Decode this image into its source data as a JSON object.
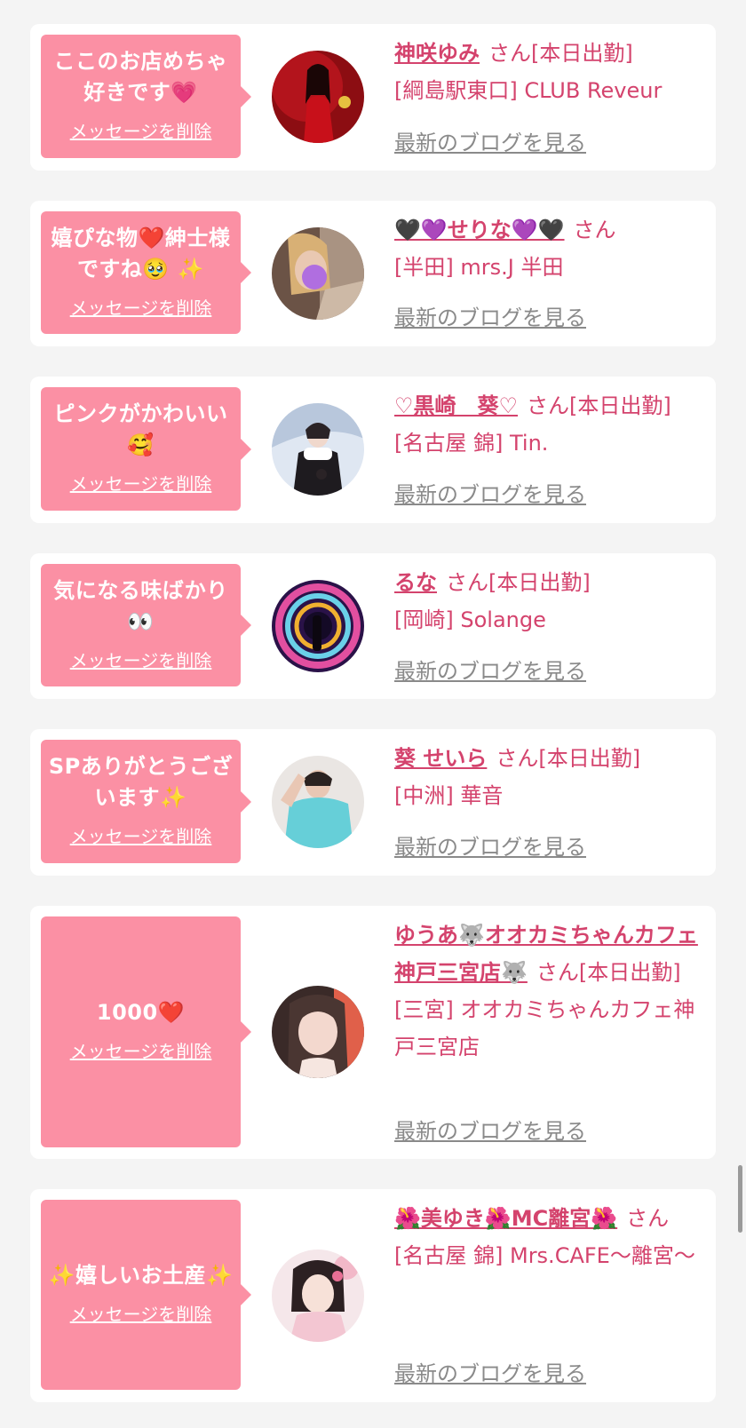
{
  "delete_label": "メッセージを削除",
  "blog_label": "最新のブログを見る",
  "san": "さん",
  "cards": [
    {
      "message": "ここのお店めちゃ好きです💗",
      "name": "神咲ゆみ",
      "status": "[本日出勤]",
      "shop": "[綱島駅東口] CLUB Reveur"
    },
    {
      "message": "嬉ぴな物❤️紳士様ですね🥹 ✨",
      "name": "🖤💜せりな💜🖤",
      "status": "",
      "shop": "[半田] mrs.J 半田"
    },
    {
      "message": "ピンクがかわいい🥰",
      "name": "♡黒崎　葵♡",
      "status": "[本日出勤]",
      "shop": "[名古屋 錦] Tin."
    },
    {
      "message": "気になる味ばかり👀",
      "name": "るな",
      "status": "[本日出勤]",
      "shop": "[岡崎] Solange"
    },
    {
      "message": "SPありがとうございます✨",
      "name": "葵 せいら",
      "status": "[本日出勤]",
      "shop": "[中洲] 華音"
    },
    {
      "message": "1000❤️",
      "name": "ゆうあ🐺オオカミちゃんカフェ神戸三宮店🐺",
      "status": "[本日出勤]",
      "shop": "[三宮] オオカミちゃんカフェ神戸三宮店"
    },
    {
      "message": "✨嬉しいお土産✨",
      "name": "🌺美ゆき🌺MC離宮🌺",
      "status": "",
      "shop": "[名古屋 錦] Mrs.CAFE〜離宮〜"
    }
  ],
  "colors": {
    "bubble": "#fb90a4",
    "accent": "#d4436d",
    "link_gray": "#8a8a8a"
  }
}
